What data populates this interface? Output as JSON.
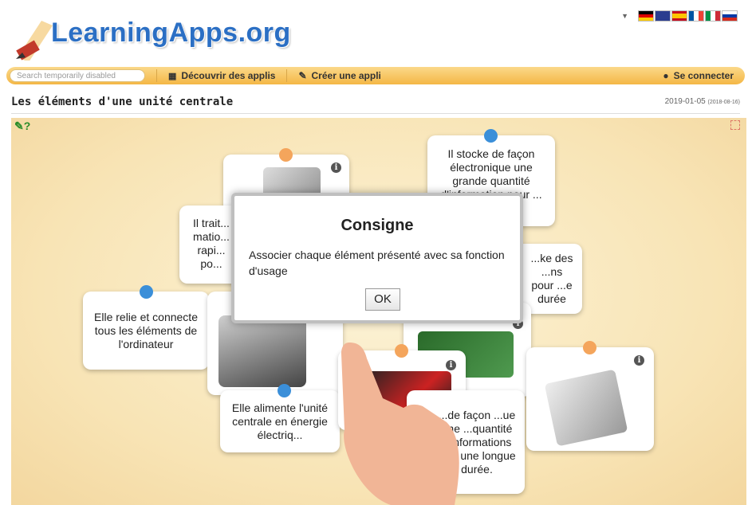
{
  "brand": {
    "logo_text": "LearningApps.org"
  },
  "language": {
    "flags": [
      "de",
      "en",
      "es",
      "fr",
      "it",
      "ru"
    ]
  },
  "navbar": {
    "search_placeholder": "Search temporarily disabled",
    "discover": "Découvrir des applis",
    "create": "Créer une appli",
    "login": "Se connecter"
  },
  "page": {
    "title": "Les éléments d'une unité centrale",
    "date": "2019-01-05",
    "date_secondary": "(2018-08-16)"
  },
  "cards": {
    "storage_top": "Il stocke de façon électronique une grande quantité d'information pour ... ée.",
    "processor_partial": "Il trait... matio... rapi... po...",
    "ram_partial": "...ke des ...ns pour ...e durée",
    "motherboard": "Elle relie et connecte tous les éléments de l'ordinateur",
    "psu": "Elle alimente l'unité centrale en énergie électriq...",
    "storage_bottom": "...de façon ...ue une ...quantité d'informations ...ur une longue durée."
  },
  "dialog": {
    "title": "Consigne",
    "text": "Associer chaque élément présenté avec sa fonction d'usage",
    "ok": "OK"
  },
  "colors": {
    "nav": "#f4b745",
    "dot_blue": "#3b8fd9",
    "dot_orange": "#f4a55c",
    "logo": "#2b6fc4"
  }
}
